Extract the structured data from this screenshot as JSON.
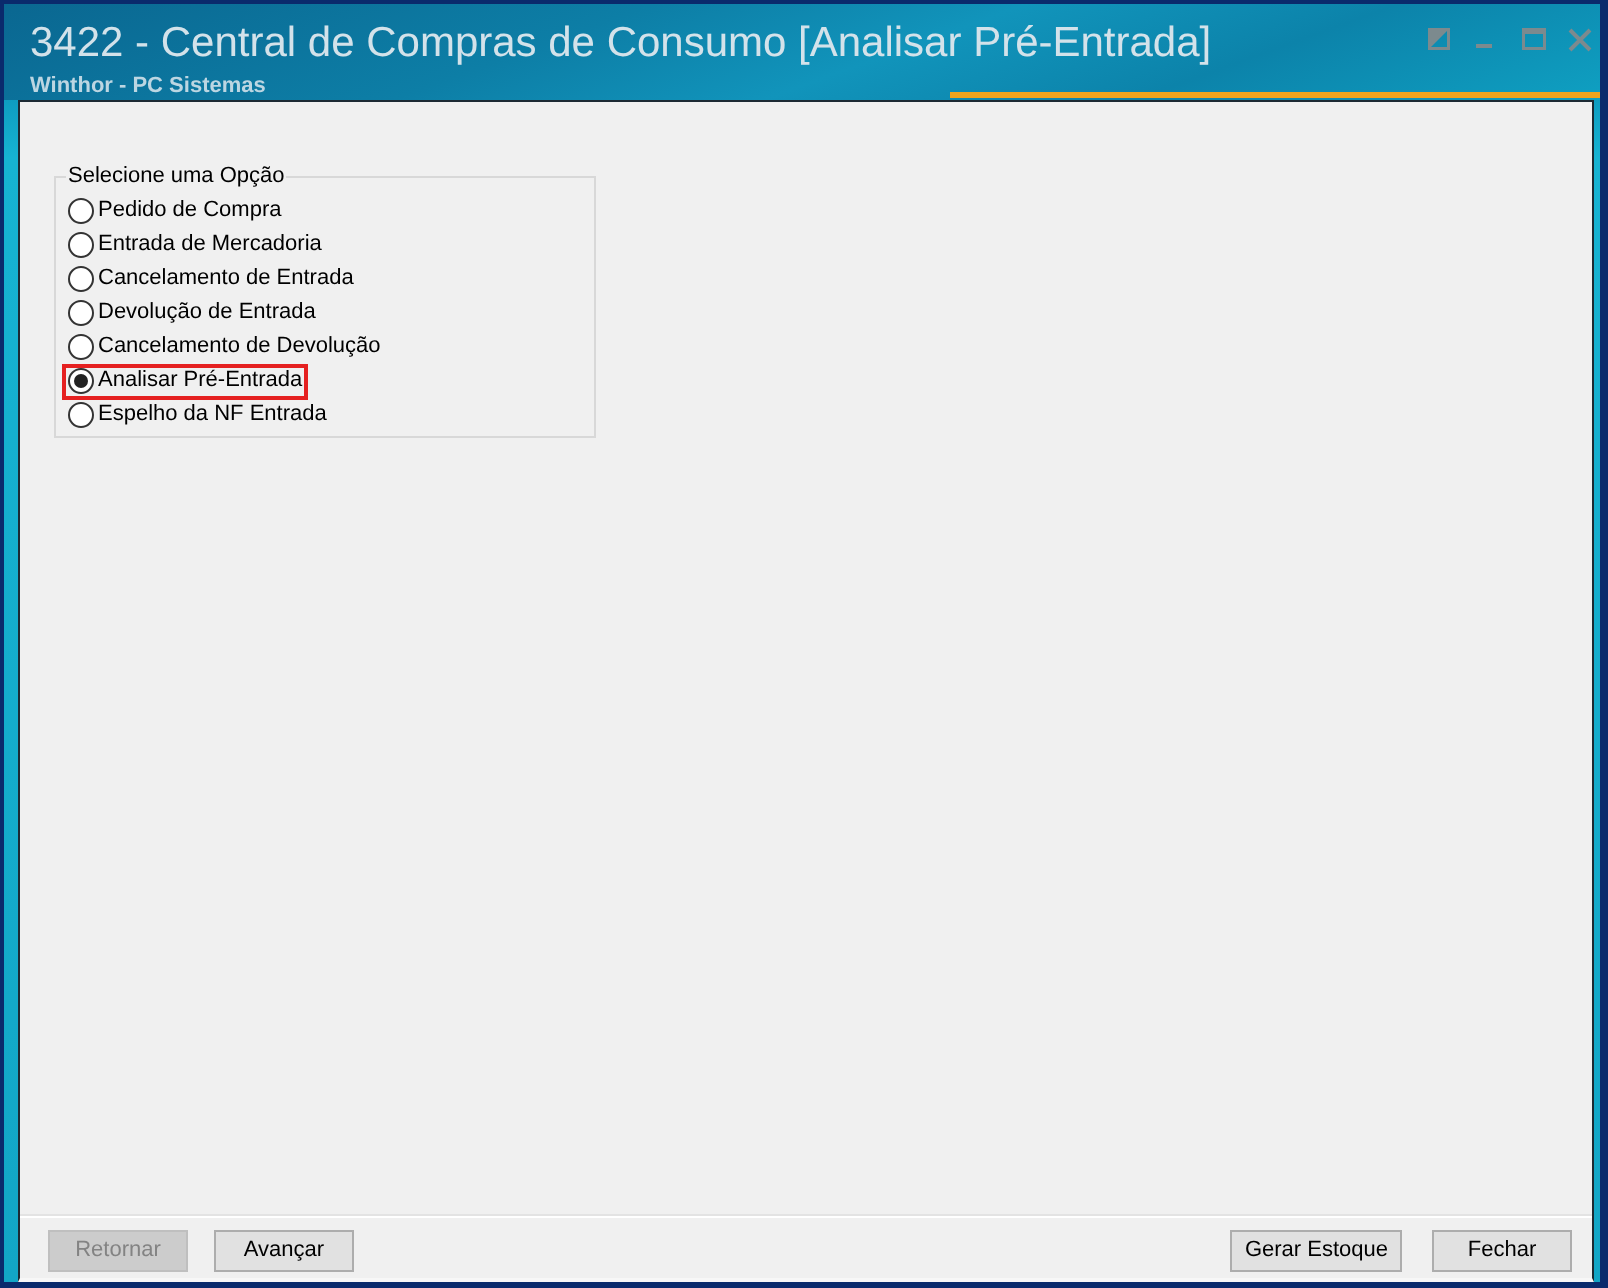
{
  "window": {
    "title": "3422 - Central de Compras de Consumo [Analisar Pré-Entrada]",
    "subtitle": "Winthor - PC Sistemas"
  },
  "option_group": {
    "legend": "Selecione uma Opção",
    "options": [
      {
        "label": "Pedido de Compra",
        "selected": false,
        "highlighted": false
      },
      {
        "label": "Entrada de Mercadoria",
        "selected": false,
        "highlighted": false
      },
      {
        "label": "Cancelamento de Entrada",
        "selected": false,
        "highlighted": false
      },
      {
        "label": "Devolução de Entrada",
        "selected": false,
        "highlighted": false
      },
      {
        "label": "Cancelamento de Devolução",
        "selected": false,
        "highlighted": false
      },
      {
        "label": "Analisar Pré-Entrada",
        "selected": true,
        "highlighted": true
      },
      {
        "label": "Espelho da NF Entrada",
        "selected": false,
        "highlighted": false
      }
    ]
  },
  "buttons_left": [
    {
      "label": "Retornar",
      "disabled": true
    },
    {
      "label": "Avançar",
      "disabled": false
    }
  ],
  "buttons_right": [
    {
      "label": "Gerar Estoque",
      "disabled": false
    },
    {
      "label": "Fechar",
      "disabled": false
    }
  ]
}
